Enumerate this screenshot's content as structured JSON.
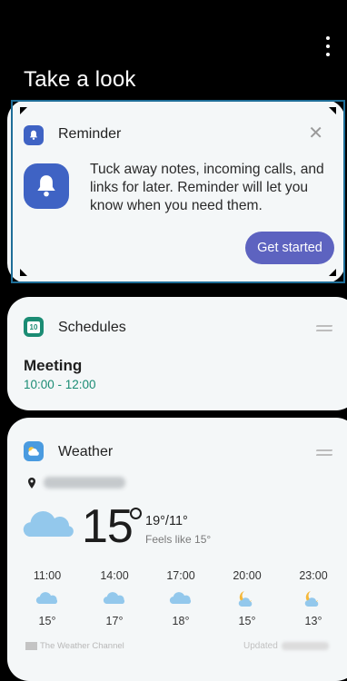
{
  "header": {
    "title": "Take a look",
    "more_icon": "more-vert-icon"
  },
  "reminder_card": {
    "title": "Reminder",
    "body": "Tuck away notes, incoming calls, and links for later. Reminder will let you know when you need them.",
    "button_label": "Get started",
    "icon": "bell-icon",
    "accent": "#3f63c4"
  },
  "schedules_card": {
    "title": "Schedules",
    "icon_text": "10",
    "event_title": "Meeting",
    "event_time": "10:00 - 12:00",
    "time_color": "#1a8c74"
  },
  "weather_card": {
    "title": "Weather",
    "current_temp": "15",
    "hi_lo": "19°/11°",
    "feels_like": "Feels like 15°",
    "hourly": [
      {
        "time": "11:00",
        "icon": "cloud-icon",
        "temp": "15°"
      },
      {
        "time": "14:00",
        "icon": "cloud-icon",
        "temp": "17°"
      },
      {
        "time": "17:00",
        "icon": "cloud-icon",
        "temp": "18°"
      },
      {
        "time": "20:00",
        "icon": "moon-cloud-icon",
        "temp": "15°"
      },
      {
        "time": "23:00",
        "icon": "moon-cloud-icon",
        "temp": "13°"
      }
    ],
    "provider": "The Weather Channel",
    "updated_label": "Updated"
  }
}
